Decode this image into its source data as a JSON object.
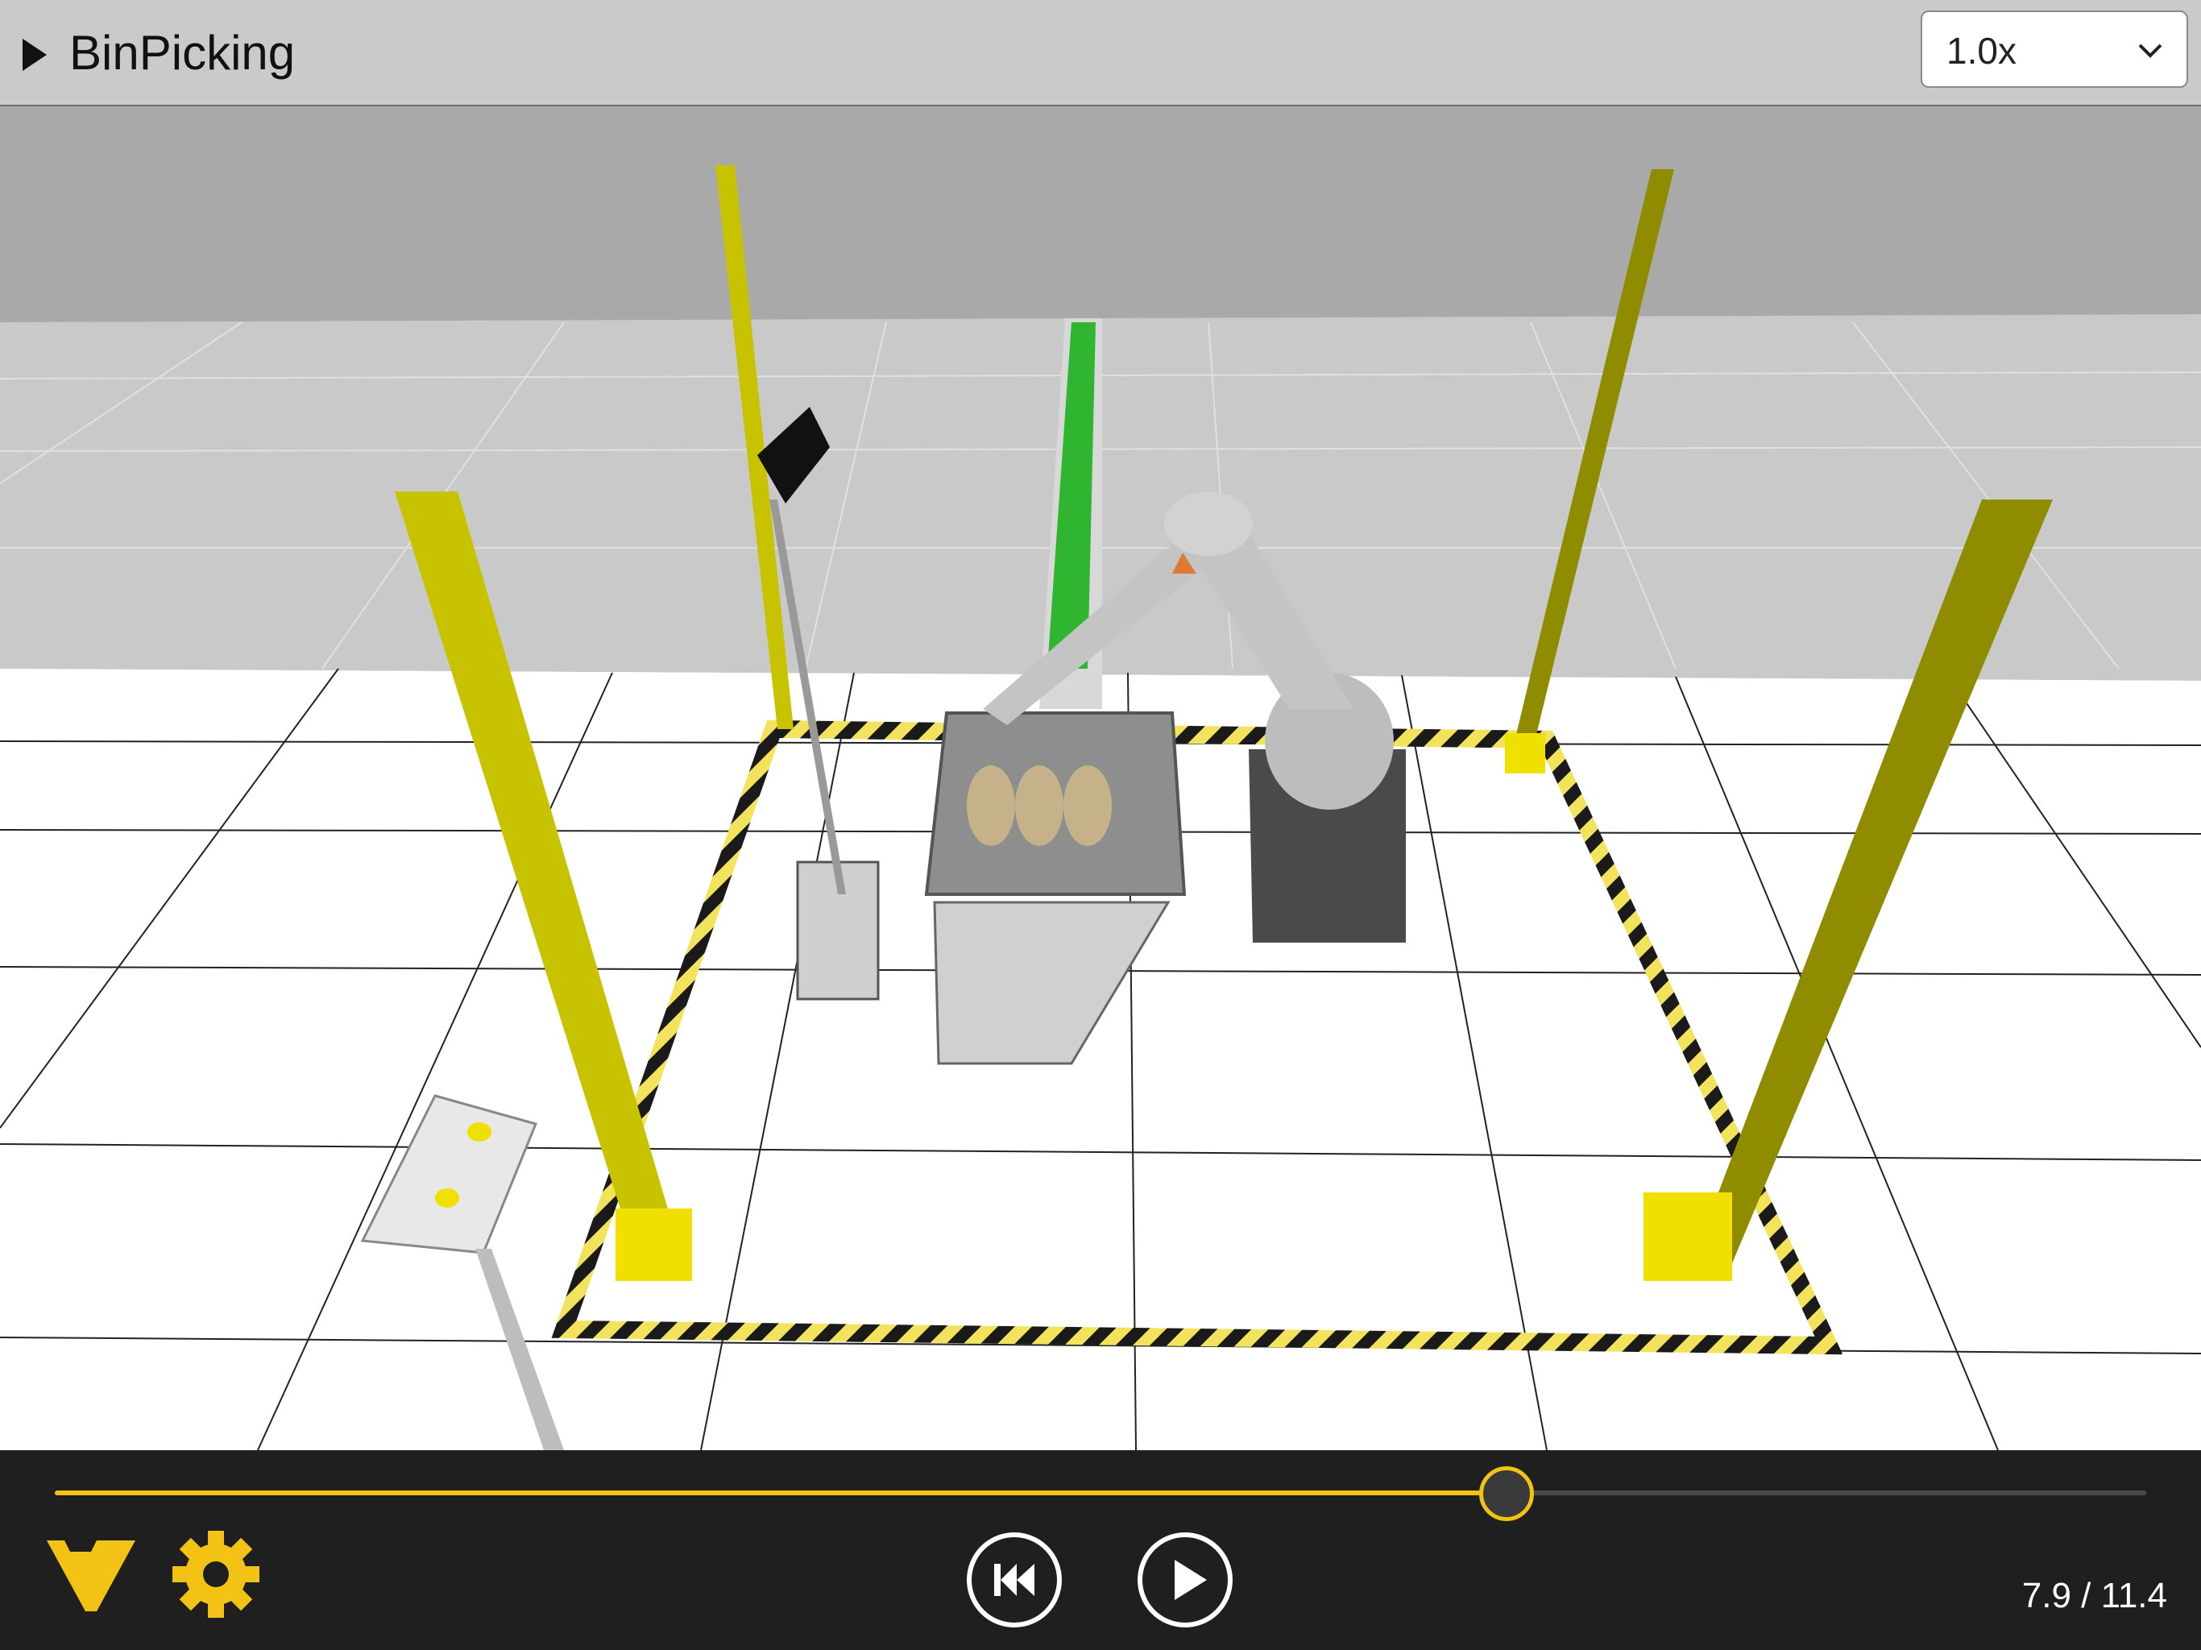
{
  "header": {
    "title": "BinPicking",
    "speed": {
      "selected": "1.0x"
    }
  },
  "playback": {
    "current_time": "7.9",
    "separator": " / ",
    "total_time": "11.4",
    "progress": 0.693
  },
  "colors": {
    "accent": "#f2c314",
    "bar_background": "#1f1f1f",
    "header_background": "#cacaca",
    "pillar_yellow": "#c8c300",
    "conveyor_green": "#2fb52f"
  },
  "icons": {
    "expand": "triangle-right",
    "speed_dropdown": "chevron-down",
    "logo": "v-logo",
    "settings": "gear",
    "rewind": "skip-to-start",
    "play": "play"
  }
}
